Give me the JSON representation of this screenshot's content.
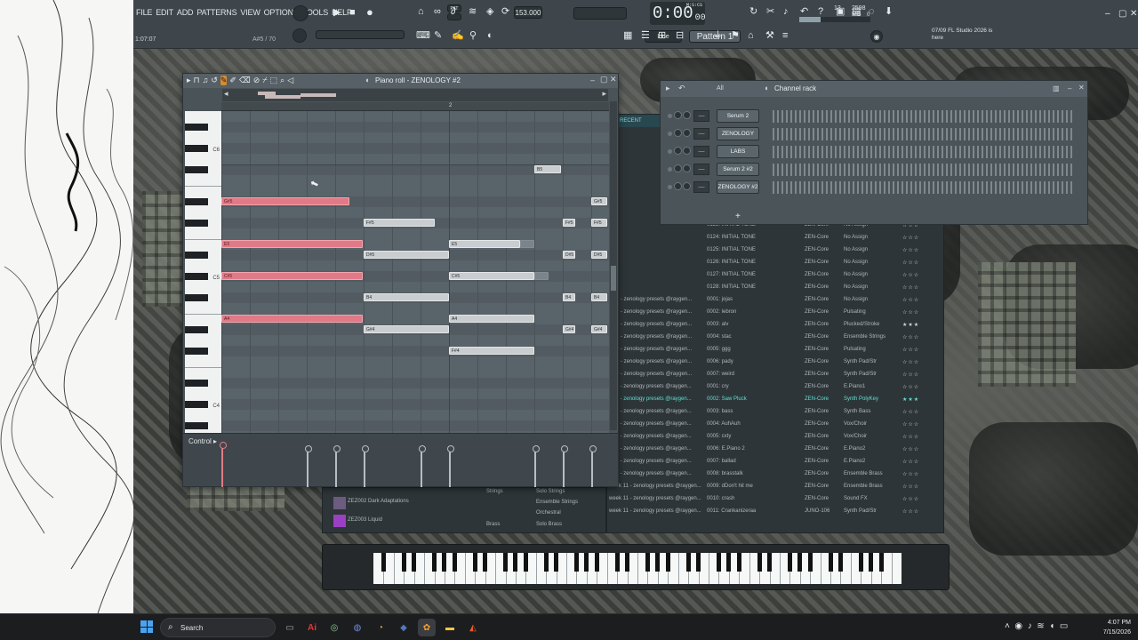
{
  "menu": [
    "FILE",
    "EDIT",
    "ADD",
    "PATTERNS",
    "VIEW",
    "OPTIONS",
    "TOOLS",
    "HELP"
  ],
  "song_position": "1:07:07",
  "hint_small": "A#5 / 70",
  "transport": {
    "pat_badge": "PAT",
    "tempo": "153.000",
    "time": "0:00",
    "time_sub": "00",
    "time_msc": "M:S:CS",
    "cpu_a": "13",
    "mem": "2598 MB",
    "mem_sub": "0"
  },
  "snap_mode": "Line",
  "pattern_selector": "Pattern 1",
  "news": "07/09  FL Studio 2026 is here",
  "piano_roll": {
    "title": "Piano roll - ZENOLOGY #2",
    "ruler": [
      "2"
    ],
    "octave_labels": [
      "C6",
      "C5",
      "C4"
    ],
    "control_label": "Control",
    "notes_red": [
      {
        "label": "G#5"
      },
      {
        "label": "E5"
      },
      {
        "label": "C#5"
      },
      {
        "label": "A4"
      }
    ],
    "notes_gray": [
      {
        "label": "B5"
      },
      {
        "label": "F#5"
      },
      {
        "label": "D#5"
      },
      {
        "label": "B4"
      },
      {
        "label": "G#4"
      },
      {
        "label": "E5"
      },
      {
        "label": "C#5"
      },
      {
        "label": "A4"
      },
      {
        "label": "F#4"
      },
      {
        "label": "G#5"
      },
      {
        "label": "F#5"
      },
      {
        "label": "F#5"
      },
      {
        "label": "D#5"
      },
      {
        "label": "D#5"
      },
      {
        "label": "B4"
      },
      {
        "label": "B4"
      },
      {
        "label": "G#4"
      },
      {
        "label": "G#4"
      }
    ]
  },
  "channel_rack": {
    "title": "Channel rack",
    "filter": "All",
    "channels": [
      "Serum 2",
      "ZENOLOGY",
      "LABS",
      "Serum 2 #2",
      "ZENOLOGY #2"
    ],
    "add": "+"
  },
  "browser": {
    "tab": "RECENT",
    "rows": [
      {
        "source": "",
        "name": "0123: INITIAL TONE",
        "engine": "ZEN-Core",
        "category": "No Assign",
        "stars": "☆☆☆",
        "selected": false
      },
      {
        "source": "",
        "name": "0124: INITIAL TONE",
        "engine": "ZEN-Core",
        "category": "No Assign",
        "stars": "☆☆☆",
        "selected": false
      },
      {
        "source": "",
        "name": "0125: INITIAL TONE",
        "engine": "ZEN-Core",
        "category": "No Assign",
        "stars": "☆☆☆",
        "selected": false
      },
      {
        "source": "",
        "name": "0126: INITIAL TONE",
        "engine": "ZEN-Core",
        "category": "No Assign",
        "stars": "☆☆☆",
        "selected": false
      },
      {
        "source": "",
        "name": "0127: INITIAL TONE",
        "engine": "ZEN-Core",
        "category": "No Assign",
        "stars": "☆☆☆",
        "selected": false
      },
      {
        "source": "",
        "name": "0128: INITIAL TONE",
        "engine": "ZEN-Core",
        "category": "No Assign",
        "stars": "☆☆☆",
        "selected": false
      },
      {
        "source": "k 10 - zenology presets @raygen...",
        "name": "0001: jojas",
        "engine": "ZEN-Core",
        "category": "No Assign",
        "stars": "☆☆☆",
        "selected": false
      },
      {
        "source": "k 10 - zenology presets @raygen...",
        "name": "0002: lebron",
        "engine": "ZEN-Core",
        "category": "Pulsating",
        "stars": "☆☆☆",
        "selected": false
      },
      {
        "source": "k 10 - zenology presets @raygen...",
        "name": "0003: alv",
        "engine": "ZEN-Core",
        "category": "Plucked/Stroke",
        "stars": "★★★",
        "selected": false
      },
      {
        "source": "k 10 - zenology presets @raygen...",
        "name": "0004: stac",
        "engine": "ZEN-Core",
        "category": "Ensemble Strings",
        "stars": "☆☆☆",
        "selected": false
      },
      {
        "source": "k 10 - zenology presets @raygen...",
        "name": "0005: ggg",
        "engine": "ZEN-Core",
        "category": "Pulsating",
        "stars": "☆☆☆",
        "selected": false
      },
      {
        "source": "k 10 - zenology presets @raygen...",
        "name": "0006: pady",
        "engine": "ZEN-Core",
        "category": "Synth Pad/Str",
        "stars": "☆☆☆",
        "selected": false
      },
      {
        "source": "k 10 - zenology presets @raygen...",
        "name": "0007: weird",
        "engine": "ZEN-Core",
        "category": "Synth Pad/Str",
        "stars": "☆☆☆",
        "selected": false
      },
      {
        "source": "k 11 - zenology presets @raygen...",
        "name": "0001: cry",
        "engine": "ZEN-Core",
        "category": "E.Piano1",
        "stars": "☆☆☆",
        "selected": false
      },
      {
        "source": "k 11 - zenology presets @raygen...",
        "name": "0002: Saw Pluck",
        "engine": "ZEN-Core",
        "category": "Synth PolyKey",
        "stars": "★★★",
        "selected": true
      },
      {
        "source": "k 11 - zenology presets @raygen...",
        "name": "0003: bass",
        "engine": "ZEN-Core",
        "category": "Synth Bass",
        "stars": "☆☆☆",
        "selected": false
      },
      {
        "source": "k 11 - zenology presets @raygen...",
        "name": "0004: AuhAuh",
        "engine": "ZEN-Core",
        "category": "Vox/Choir",
        "stars": "☆☆☆",
        "selected": false
      },
      {
        "source": "k 11 - zenology presets @raygen...",
        "name": "0005: cxty",
        "engine": "ZEN-Core",
        "category": "Vox/Choir",
        "stars": "☆☆☆",
        "selected": false
      },
      {
        "source": "k 11 - zenology presets @raygen...",
        "name": "0006: E.Piano 2",
        "engine": "ZEN-Core",
        "category": "E.Piano2",
        "stars": "☆☆☆",
        "selected": false
      },
      {
        "source": "k 11 - zenology presets @raygen...",
        "name": "0007: ballad",
        "engine": "ZEN-Core",
        "category": "E.Piano2",
        "stars": "☆☆☆",
        "selected": false
      },
      {
        "source": "k 11 - zenology presets @raygen...",
        "name": "0008: brasstalk",
        "engine": "ZEN-Core",
        "category": "Ensemble Brass",
        "stars": "☆☆☆",
        "selected": false
      },
      {
        "source": "week 11 - zenology presets @raygen...",
        "name": "0009: dDon't hit me",
        "engine": "ZEN-Core",
        "category": "Ensemble Brass",
        "stars": "☆☆☆",
        "selected": false
      },
      {
        "source": "week 11 - zenology presets @raygen...",
        "name": "0010: crash",
        "engine": "ZEN-Core",
        "category": "Sound FX",
        "stars": "☆☆☆",
        "selected": false
      },
      {
        "source": "week 11 - zenology presets @raygen...",
        "name": "0011: Crankanizeraa",
        "engine": "JUNO-106",
        "category": "Synth Pad/Str",
        "stars": "☆☆☆",
        "selected": false
      }
    ]
  },
  "instrument_panel": {
    "items": [
      "ZEZ002 Dark Adaptations",
      "ZEZ003 Liquid"
    ],
    "cats_a": [
      "Strings",
      "Brass"
    ],
    "cats_b": [
      "Solo Strings",
      "Ensemble Strings",
      "Orchestral",
      "Solo Brass"
    ]
  },
  "taskbar": {
    "search_label": "Search",
    "time": "4:07 PM",
    "date": "7/15/2026"
  }
}
